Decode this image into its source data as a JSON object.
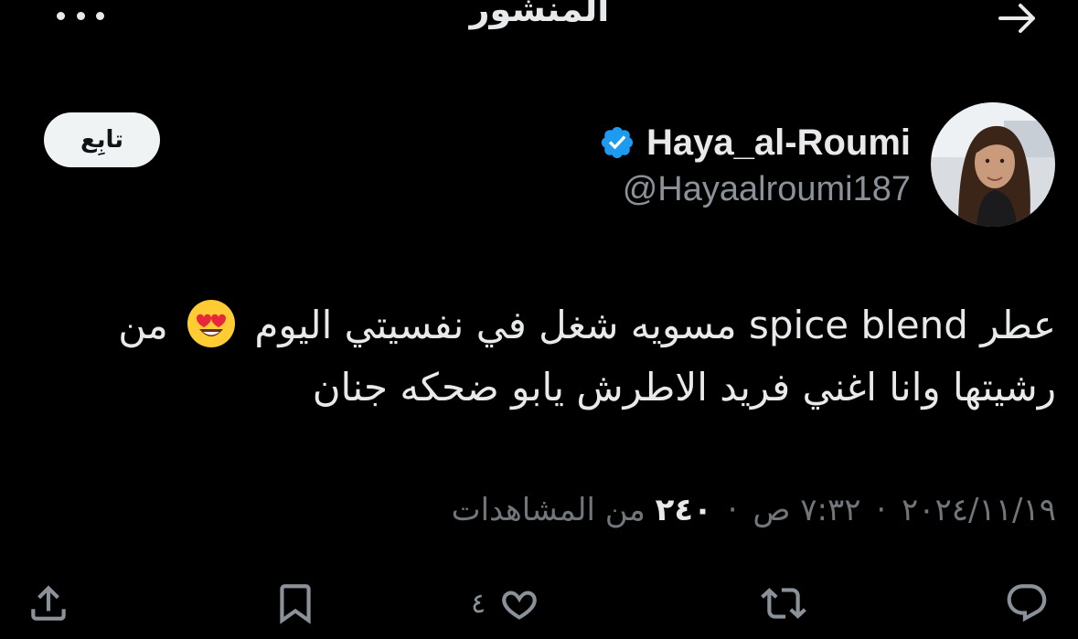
{
  "header": {
    "title": "المنشور",
    "more_icon": "more-horizontal-icon",
    "back_icon": "arrow-right-icon"
  },
  "author": {
    "display_name": "Haya_al-Roumi",
    "handle": "@Hayaalroumi187",
    "verified_icon": "verified-badge-icon",
    "verified_color": "#1d9bf0",
    "follow_label": "تابِع"
  },
  "tweet": {
    "line1_before_emoji": "عطر spice blend مسويه شغل في نفسيتي اليوم",
    "emoji_icon": "heart-eyes-emoji",
    "line1_after_emoji": "من",
    "line2": "رشيتها وانا اغني فريد الاطرش يابو ضحكه جنان"
  },
  "meta": {
    "time": "٧:٣٢ ص",
    "date": "٢٠٢٤/١١/١٩",
    "views_count": "٢٤٠",
    "views_label": "من المشاهدات",
    "separator": "·"
  },
  "actions": {
    "reply_icon": "reply-icon",
    "repost_icon": "repost-icon",
    "like_icon": "heart-icon",
    "like_count": "٤",
    "bookmark_icon": "bookmark-icon",
    "share_icon": "share-icon"
  },
  "colors": {
    "background": "#000000",
    "text": "#e7e9ea",
    "muted": "#71767b",
    "accent": "#1d9bf0"
  }
}
